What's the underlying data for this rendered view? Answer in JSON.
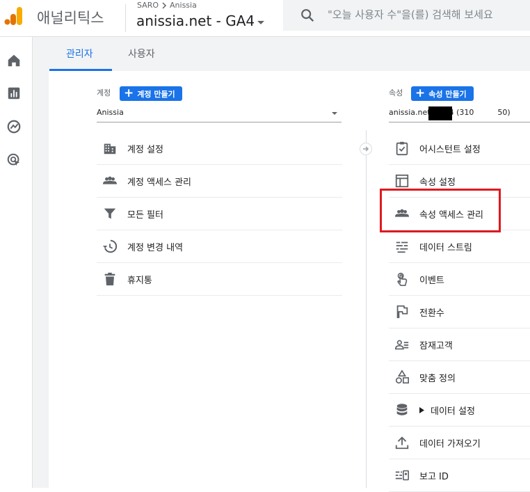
{
  "header": {
    "app_title": "애널리틱스",
    "breadcrumb_parent": "SARO",
    "breadcrumb_child": "Anissia",
    "property_title": "anissia.net - GA4",
    "search_placeholder": "\"오늘 사용자 수\"을(를) 검색해 보세요"
  },
  "rail": {
    "items": [
      "home-icon",
      "reports-icon",
      "explore-icon",
      "advertising-icon"
    ]
  },
  "tabs": [
    {
      "label": "관리자",
      "active": true
    },
    {
      "label": "사용자",
      "active": false
    }
  ],
  "account": {
    "label": "계정",
    "create_label": "계정 만들기",
    "selected": "Anissia",
    "items": [
      {
        "label": "계정 설정",
        "icon": "building-icon"
      },
      {
        "label": "계정 액세스 관리",
        "icon": "people-icon"
      },
      {
        "label": "모든 필터",
        "icon": "filter-icon"
      },
      {
        "label": "계정 변경 내역",
        "icon": "history-icon"
      },
      {
        "label": "휴지통",
        "icon": "trash-icon"
      }
    ]
  },
  "property": {
    "label": "속성",
    "create_label": "속성 만들기",
    "selected_prefix": "anissia.net - GA4 (310",
    "selected_suffix": "50)",
    "items": [
      {
        "label": "어시스턴트 설정",
        "icon": "clipboard-check-icon"
      },
      {
        "label": "속성 설정",
        "icon": "layout-icon"
      },
      {
        "label": "속성 액세스 관리",
        "icon": "people-icon"
      },
      {
        "label": "데이터 스트림",
        "icon": "streams-icon"
      },
      {
        "label": "이벤트",
        "icon": "touch-icon"
      },
      {
        "label": "전환수",
        "icon": "flag-icon"
      },
      {
        "label": "잠재고객",
        "icon": "audience-icon"
      },
      {
        "label": "맞춤 정의",
        "icon": "shapes-icon"
      },
      {
        "label": "데이터 설정",
        "icon": "database-icon"
      },
      {
        "label": "데이터 가져오기",
        "icon": "upload-icon"
      },
      {
        "label": "보고 ID",
        "icon": "reporting-id-icon"
      }
    ]
  },
  "colors": {
    "accent": "#1a73e8",
    "highlight": "#e0191f"
  }
}
